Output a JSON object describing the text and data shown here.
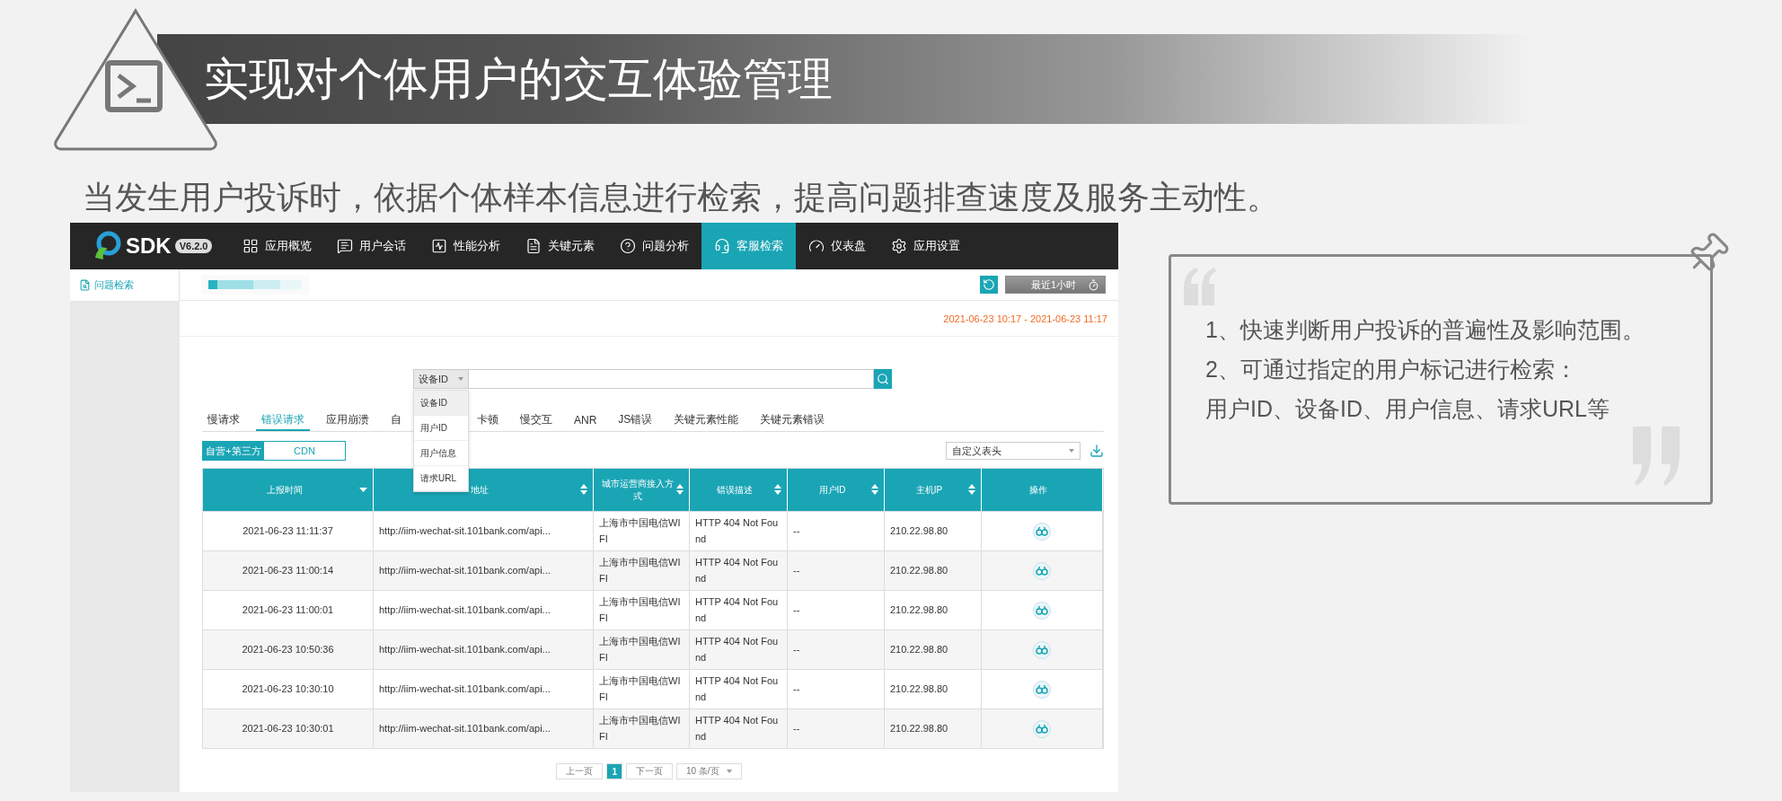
{
  "slide": {
    "title": "实现对个体用户的交互体验管理",
    "subtitle": "当发生用户投诉时，依据个体样本信息进行检索，提高问题排查速度及服务主动性。"
  },
  "app": {
    "brand": "SDK",
    "version": "V6.2.0",
    "nav": [
      {
        "label": "应用概览",
        "selected": false
      },
      {
        "label": "用户会话",
        "selected": false
      },
      {
        "label": "性能分析",
        "selected": false
      },
      {
        "label": "关键元素",
        "selected": false
      },
      {
        "label": "问题分析",
        "selected": false
      },
      {
        "label": "客服检索",
        "selected": true
      },
      {
        "label": "仪表盘",
        "selected": false
      },
      {
        "label": "应用设置",
        "selected": false
      }
    ],
    "sidebar": [
      {
        "label": "问题检索",
        "selected": true
      }
    ],
    "time_button": "最近1小时",
    "date_range": "2021-06-23 10:17 - 2021-06-23 11:17",
    "search": {
      "field_type": "设备ID",
      "options": [
        {
          "label": "设备ID",
          "selected": true
        },
        {
          "label": "用户ID",
          "selected": false
        },
        {
          "label": "用户信息",
          "selected": false
        },
        {
          "label": "请求URL",
          "selected": false
        }
      ]
    },
    "tabs": [
      {
        "label": "慢请求",
        "selected": false
      },
      {
        "label": "错误请求",
        "selected": true
      },
      {
        "label": "应用崩溃",
        "selected": false
      },
      {
        "label": "自",
        "selected": false
      },
      {
        "label": "卡顿",
        "selected": false
      },
      {
        "label": "慢交互",
        "selected": false
      },
      {
        "label": "ANR",
        "selected": false
      },
      {
        "label": "JS错误",
        "selected": false
      },
      {
        "label": "关键元素性能",
        "selected": false
      },
      {
        "label": "关键元素错误",
        "selected": false
      }
    ],
    "source_toggle": [
      {
        "label": "自营+第三方",
        "selected": true
      },
      {
        "label": "CDN",
        "selected": false
      }
    ],
    "column_picker": "自定义表头",
    "table": {
      "columns": [
        {
          "label": "上报时间",
          "sortable": true,
          "sorted": true
        },
        {
          "label": "地址",
          "sortable": true,
          "sorted": false
        },
        {
          "label": "城市运营商接入方式",
          "sortable": true,
          "sorted": false
        },
        {
          "label": "错误描述",
          "sortable": true,
          "sorted": false
        },
        {
          "label": "用户ID",
          "sortable": true,
          "sorted": false
        },
        {
          "label": "主机IP",
          "sortable": true,
          "sorted": false
        },
        {
          "label": "操作",
          "sortable": false
        }
      ],
      "rows": [
        [
          "2021-06-23 11:11:37",
          "http://iim-wechat-sit.101bank.com/api...",
          "上海市中国电信WIFI",
          "HTTP 404 Not Found",
          "--",
          "210.22.98.80"
        ],
        [
          "2021-06-23 11:00:14",
          "http://iim-wechat-sit.101bank.com/api...",
          "上海市中国电信WIFI",
          "HTTP 404 Not Found",
          "--",
          "210.22.98.80"
        ],
        [
          "2021-06-23 11:00:01",
          "http://iim-wechat-sit.101bank.com/api...",
          "上海市中国电信WIFI",
          "HTTP 404 Not Found",
          "--",
          "210.22.98.80"
        ],
        [
          "2021-06-23 10:50:36",
          "http://iim-wechat-sit.101bank.com/api...",
          "上海市中国电信WIFI",
          "HTTP 404 Not Found",
          "--",
          "210.22.98.80"
        ],
        [
          "2021-06-23 10:30:10",
          "http://iim-wechat-sit.101bank.com/api...",
          "上海市中国电信WIFI",
          "HTTP 404 Not Found",
          "--",
          "210.22.98.80"
        ],
        [
          "2021-06-23 10:30:01",
          "http://iim-wechat-sit.101bank.com/api...",
          "上海市中国电信WIFI",
          "HTTP 404 Not Found",
          "--",
          "210.22.98.80"
        ]
      ]
    },
    "pagination": {
      "prev": "上一页",
      "pages": [
        {
          "label": "1",
          "selected": true
        }
      ],
      "next": "下一页",
      "page_size": "10 条/页"
    }
  },
  "callout": {
    "lines": [
      "1、快速判断用户投诉的普遍性及影响范围。",
      "2、可通过指定的用户标记进行检索：",
      "用户ID、设备ID、用户信息、请求URL等"
    ]
  }
}
